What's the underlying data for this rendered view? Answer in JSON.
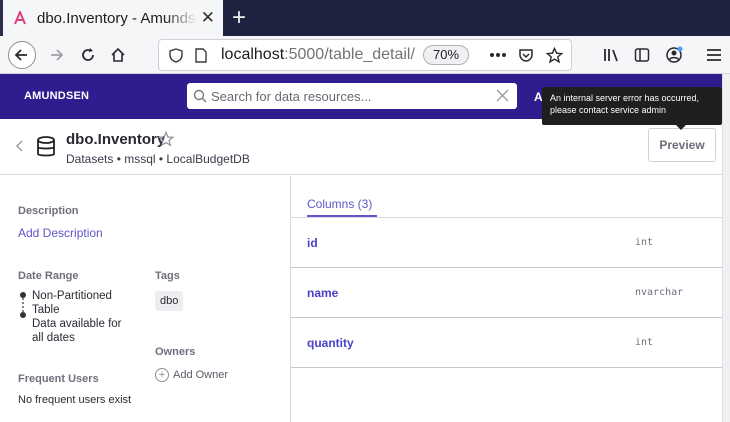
{
  "browser": {
    "tab_title": "dbo.Inventory - Amundsen",
    "tab_close_symbol": "✕",
    "new_tab_symbol": "+",
    "url_host": "localhost",
    "url_path": ":5000/table_detail/",
    "zoom": "70%",
    "icons": [
      "amundsen-favicon-icon",
      "back-arrow-icon",
      "forward-arrow-icon",
      "reload-icon",
      "home-icon",
      "shield-icon",
      "page-icon",
      "more-icon",
      "pocket-icon",
      "bookmark-star-icon",
      "library-icon",
      "sidebar-icon",
      "account-icon",
      "menu-icon"
    ]
  },
  "app": {
    "brand": "AMUNDSEN",
    "search_placeholder": "Search for data resources...",
    "nav_link_initial": "A",
    "tooltip": "An internal server error has occurred, please contact service admin"
  },
  "header": {
    "title": "dbo.Inventory",
    "subtitle": "Datasets • mssql • LocalBudgetDB",
    "preview_label": "Preview"
  },
  "left": {
    "description_label": "Description",
    "add_description": "Add Description",
    "date_range_label": "Date Range",
    "date_range_line1": "Non-Partitioned",
    "date_range_line2": "Table",
    "date_range_line3": "Data available for",
    "date_range_line4": "all dates",
    "tags_label": "Tags",
    "tags": [
      "dbo"
    ],
    "owners_label": "Owners",
    "add_owner": "Add Owner",
    "frequent_users_label": "Frequent Users",
    "frequent_users_text": "No frequent users exist"
  },
  "columns": {
    "tab_label": "Columns (3)",
    "rows": [
      {
        "name": "id",
        "type": "int"
      },
      {
        "name": "name",
        "type": "nvarchar"
      },
      {
        "name": "quantity",
        "type": "int"
      }
    ]
  },
  "colors": {
    "app_nav": "#2d1d8f",
    "accent": "#5f56c9",
    "browser_tabstrip": "#202340"
  }
}
